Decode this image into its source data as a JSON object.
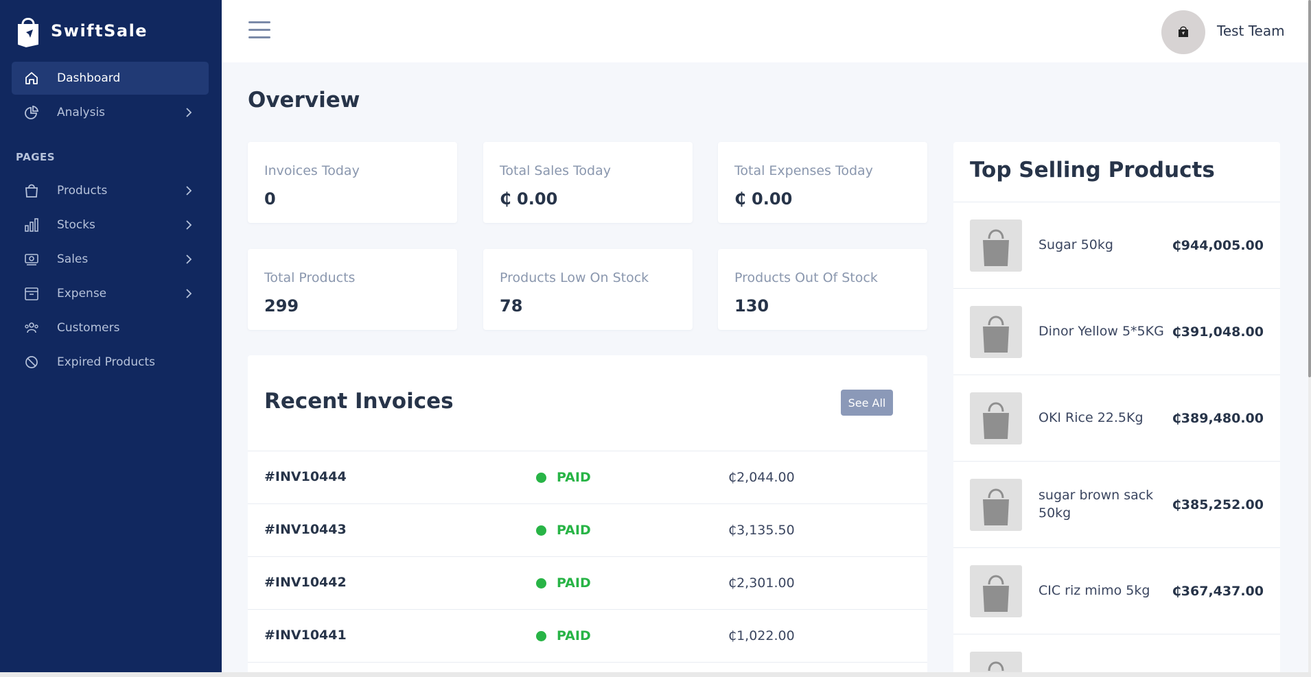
{
  "app": {
    "name": "SwiftSale"
  },
  "sidebar": {
    "items": [
      {
        "label": "Dashboard",
        "icon": "home-icon",
        "active": true
      },
      {
        "label": "Analysis",
        "icon": "pie-chart-icon",
        "has_submenu": true
      }
    ],
    "section_label": "PAGES",
    "pages": [
      {
        "label": "Products",
        "icon": "shopping-bag-icon",
        "has_submenu": true
      },
      {
        "label": "Stocks",
        "icon": "bar-chart-icon",
        "has_submenu": true
      },
      {
        "label": "Sales",
        "icon": "money-icon",
        "has_submenu": true
      },
      {
        "label": "Expense",
        "icon": "archive-box-icon",
        "has_submenu": true
      },
      {
        "label": "Customers",
        "icon": "users-icon",
        "has_submenu": false
      },
      {
        "label": "Expired Products",
        "icon": "ban-icon",
        "has_submenu": false
      }
    ]
  },
  "topbar": {
    "user_name": "Test Team"
  },
  "main": {
    "title": "Overview",
    "stats": [
      {
        "label": "Invoices Today",
        "value": "0"
      },
      {
        "label": "Total Sales Today",
        "value": "₵ 0.00"
      },
      {
        "label": "Total Expenses Today",
        "value": "₵ 0.00"
      },
      {
        "label": "Total Products",
        "value": "299"
      },
      {
        "label": "Products Low On Stock",
        "value": "78"
      },
      {
        "label": "Products Out Of Stock",
        "value": "130"
      }
    ],
    "recent_invoices": {
      "title": "Recent Invoices",
      "see_all_label": "See All",
      "rows": [
        {
          "id": "#INV10444",
          "status": "PAID",
          "amount": "₵2,044.00"
        },
        {
          "id": "#INV10443",
          "status": "PAID",
          "amount": "₵3,135.50"
        },
        {
          "id": "#INV10442",
          "status": "PAID",
          "amount": "₵2,301.00"
        },
        {
          "id": "#INV10441",
          "status": "PAID",
          "amount": "₵1,022.00"
        }
      ]
    }
  },
  "top_selling": {
    "title": "Top Selling Products",
    "products": [
      {
        "name": "Sugar 50kg",
        "value": "₵944,005.00"
      },
      {
        "name": "Dinor Yellow 5*5KG",
        "value": "₵391,048.00"
      },
      {
        "name": "OKI Rice 22.5Kg",
        "value": "₵389,480.00"
      },
      {
        "name": "sugar brown sack 50kg",
        "value": "₵385,252.00"
      },
      {
        "name": "CIC riz mimo 5kg",
        "value": "₵367,437.00"
      }
    ]
  },
  "colors": {
    "sidebar_bg": "#11285f",
    "sidebar_active": "#213a75",
    "paid_green": "#28b446",
    "button_bg": "#8b99b8"
  }
}
